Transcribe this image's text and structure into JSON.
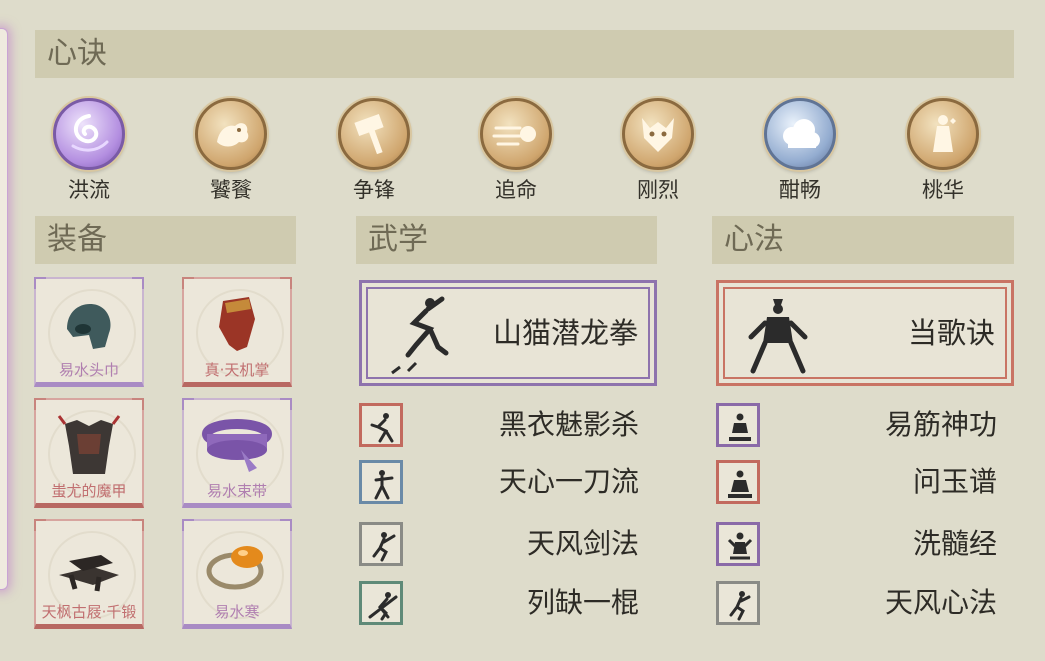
{
  "sections": {
    "xinjue": "心诀",
    "zhuangbei": "装备",
    "wuxue": "武学",
    "xinfa": "心法"
  },
  "skills": [
    {
      "label": "洪流",
      "icon": "wave-swirl-icon",
      "color": "purple"
    },
    {
      "label": "饕餮",
      "icon": "beast-icon",
      "color": "gold"
    },
    {
      "label": "争锋",
      "icon": "hammer-icon",
      "color": "gold"
    },
    {
      "label": "追命",
      "icon": "dash-icon",
      "color": "gold"
    },
    {
      "label": "刚烈",
      "icon": "wolf-head-icon",
      "color": "gold"
    },
    {
      "label": "酣畅",
      "icon": "cloud-icon",
      "color": "blue"
    },
    {
      "label": "桃华",
      "icon": "figure-icon",
      "color": "gold"
    }
  ],
  "equipment": [
    {
      "name": "易水头巾",
      "icon": "headscarf-icon",
      "quality": "purple"
    },
    {
      "name": "真·天机掌",
      "icon": "gauntlet-icon",
      "quality": "red"
    },
    {
      "name": "蚩尤的魔甲",
      "icon": "armor-icon",
      "quality": "red"
    },
    {
      "name": "易水束带",
      "icon": "belt-icon",
      "quality": "purple"
    },
    {
      "name": "天枫古屐·千锻",
      "icon": "clogs-icon",
      "quality": "red"
    },
    {
      "name": "易水寒",
      "icon": "ring-icon",
      "quality": "purple"
    }
  ],
  "wuxue": {
    "main": {
      "title": "山猫潜龙拳",
      "icon": "martial-pose-icon",
      "quality": "purple"
    },
    "list": [
      {
        "title": "黑衣魅影杀",
        "icon": "martial-pose-icon",
        "quality": "red"
      },
      {
        "title": "天心一刀流",
        "icon": "martial-pose-icon",
        "quality": "blue"
      },
      {
        "title": "天风剑法",
        "icon": "martial-pose-icon",
        "quality": "gray"
      },
      {
        "title": "列缺一棍",
        "icon": "martial-pose-icon",
        "quality": "green"
      }
    ]
  },
  "xinfa": {
    "main": {
      "title": "当歌诀",
      "icon": "stance-icon",
      "quality": "red"
    },
    "list": [
      {
        "title": "易筋神功",
        "icon": "meditation-icon",
        "quality": "purple"
      },
      {
        "title": "问玉谱",
        "icon": "meditation-icon",
        "quality": "red"
      },
      {
        "title": "洗髓经",
        "icon": "meditation-icon",
        "quality": "purple"
      },
      {
        "title": "天风心法",
        "icon": "martial-pose-icon",
        "quality": "gray"
      }
    ]
  }
}
